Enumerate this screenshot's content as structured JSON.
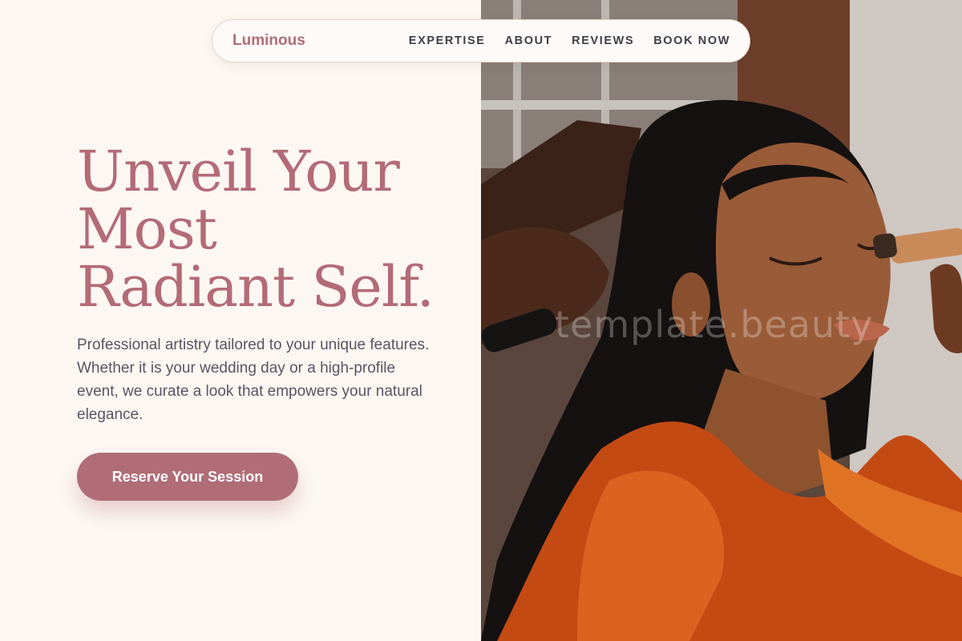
{
  "nav": {
    "brand": "Luminous",
    "links": [
      "EXPERTISE",
      "ABOUT",
      "REVIEWS",
      "BOOK NOW"
    ]
  },
  "hero": {
    "headline_lines": [
      "Unveil Your",
      "Most",
      "Radiant Self."
    ],
    "description": "Professional artistry tailored to your unique features. Whether it is your wedding day or a high-profile event, we curate a look that empowers your natural elegance.",
    "cta_label": "Reserve Your Session"
  },
  "photo": {
    "watermark": "template.beauty"
  },
  "colors": {
    "accent": "#b06d78",
    "background": "#fdf7f2",
    "text": "#5a5560"
  }
}
